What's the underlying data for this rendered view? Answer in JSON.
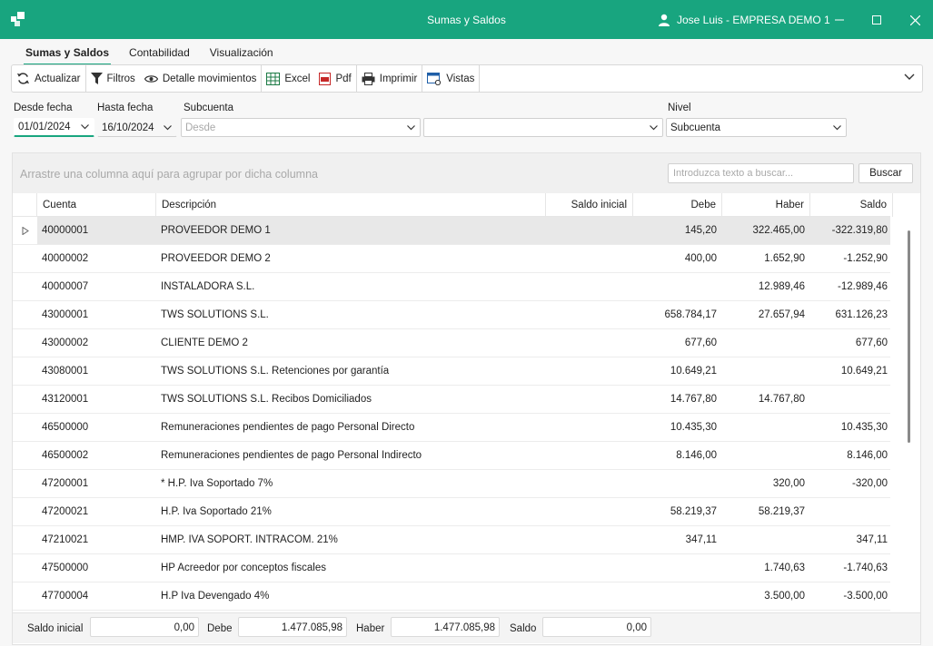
{
  "window": {
    "title": "Sumas y Saldos",
    "user": "Jose Luis - EMPRESA DEMO 1",
    "accent_color": "#18a57f"
  },
  "tabs": [
    {
      "label": "Sumas y Saldos",
      "active": true
    },
    {
      "label": "Contabilidad",
      "active": false
    },
    {
      "label": "Visualización",
      "active": false
    }
  ],
  "toolbar": {
    "refresh": {
      "label": "Actualizar",
      "icon": "refresh-icon"
    },
    "filters": {
      "label": "Filtros",
      "icon": "filter-icon"
    },
    "details": {
      "label": "Detalle movimientos",
      "icon": "eye-icon"
    },
    "excel": {
      "label": "Excel",
      "icon": "excel-icon"
    },
    "pdf": {
      "label": "Pdf",
      "icon": "pdf-icon"
    },
    "print": {
      "label": "Imprimir",
      "icon": "printer-icon"
    },
    "views": {
      "label": "Vistas",
      "icon": "views-icon"
    }
  },
  "filters": {
    "from_date": {
      "label": "Desde fecha",
      "value": "01/01/2024"
    },
    "to_date": {
      "label": "Hasta fecha",
      "value": "16/10/2024"
    },
    "subaccount": {
      "label": "Subcuenta",
      "placeholder": "Desde",
      "value": ""
    },
    "subaccount_to": {
      "value": ""
    },
    "level": {
      "label": "Nivel",
      "value": "Subcuenta"
    }
  },
  "grid": {
    "group_hint": "Arrastre una columna aquí para agrupar por dicha columna",
    "search_placeholder": "Introduzca texto a buscar...",
    "search_button": "Buscar",
    "columns": {
      "cuenta": "Cuenta",
      "descripcion": "Descripción",
      "saldo_inicial": "Saldo inicial",
      "debe": "Debe",
      "haber": "Haber",
      "saldo": "Saldo"
    },
    "rows": [
      {
        "cuenta": "40000001",
        "descripcion": "PROVEEDOR DEMO 1",
        "saldo_inicial": "",
        "debe": "145,20",
        "haber": "322.465,00",
        "saldo": "-322.319,80"
      },
      {
        "cuenta": "40000002",
        "descripcion": "PROVEEDOR DEMO 2",
        "saldo_inicial": "",
        "debe": "400,00",
        "haber": "1.652,90",
        "saldo": "-1.252,90"
      },
      {
        "cuenta": "40000007",
        "descripcion": "INSTALADORA S.L.",
        "saldo_inicial": "",
        "debe": "",
        "haber": "12.989,46",
        "saldo": "-12.989,46"
      },
      {
        "cuenta": "43000001",
        "descripcion": "TWS SOLUTIONS S.L.",
        "saldo_inicial": "",
        "debe": "658.784,17",
        "haber": "27.657,94",
        "saldo": "631.126,23"
      },
      {
        "cuenta": "43000002",
        "descripcion": "CLIENTE DEMO 2",
        "saldo_inicial": "",
        "debe": "677,60",
        "haber": "",
        "saldo": "677,60"
      },
      {
        "cuenta": "43080001",
        "descripcion": "TWS SOLUTIONS S.L. Retenciones por garantía",
        "saldo_inicial": "",
        "debe": "10.649,21",
        "haber": "",
        "saldo": "10.649,21"
      },
      {
        "cuenta": "43120001",
        "descripcion": "TWS SOLUTIONS S.L. Recibos Domiciliados",
        "saldo_inicial": "",
        "debe": "14.767,80",
        "haber": "14.767,80",
        "saldo": ""
      },
      {
        "cuenta": "46500000",
        "descripcion": "Remuneraciones pendientes de pago Personal Directo",
        "saldo_inicial": "",
        "debe": "10.435,30",
        "haber": "",
        "saldo": "10.435,30"
      },
      {
        "cuenta": "46500002",
        "descripcion": "Remuneraciones pendientes de pago Personal Indirecto",
        "saldo_inicial": "",
        "debe": "8.146,00",
        "haber": "",
        "saldo": "8.146,00"
      },
      {
        "cuenta": "47200001",
        "descripcion": "* H.P. Iva Soportado 7%",
        "saldo_inicial": "",
        "debe": "",
        "haber": "320,00",
        "saldo": "-320,00"
      },
      {
        "cuenta": "47200021",
        "descripcion": "H.P. Iva Soportado 21%",
        "saldo_inicial": "",
        "debe": "58.219,37",
        "haber": "58.219,37",
        "saldo": ""
      },
      {
        "cuenta": "47210021",
        "descripcion": "HMP. IVA SOPORT. INTRACOM. 21%",
        "saldo_inicial": "",
        "debe": "347,11",
        "haber": "",
        "saldo": "347,11"
      },
      {
        "cuenta": "47500000",
        "descripcion": "HP Acreedor por conceptos fiscales",
        "saldo_inicial": "",
        "debe": "",
        "haber": "1.740,63",
        "saldo": "-1.740,63"
      },
      {
        "cuenta": "47700004",
        "descripcion": "H.P Iva Devengado 4%",
        "saldo_inicial": "",
        "debe": "",
        "haber": "3.500,00",
        "saldo": "-3.500,00"
      }
    ]
  },
  "totals": {
    "saldo_inicial": {
      "label": "Saldo inicial",
      "value": "0,00"
    },
    "debe": {
      "label": "Debe",
      "value": "1.477.085,98"
    },
    "haber": {
      "label": "Haber",
      "value": "1.477.085,98"
    },
    "saldo": {
      "label": "Saldo",
      "value": "0,00"
    }
  }
}
